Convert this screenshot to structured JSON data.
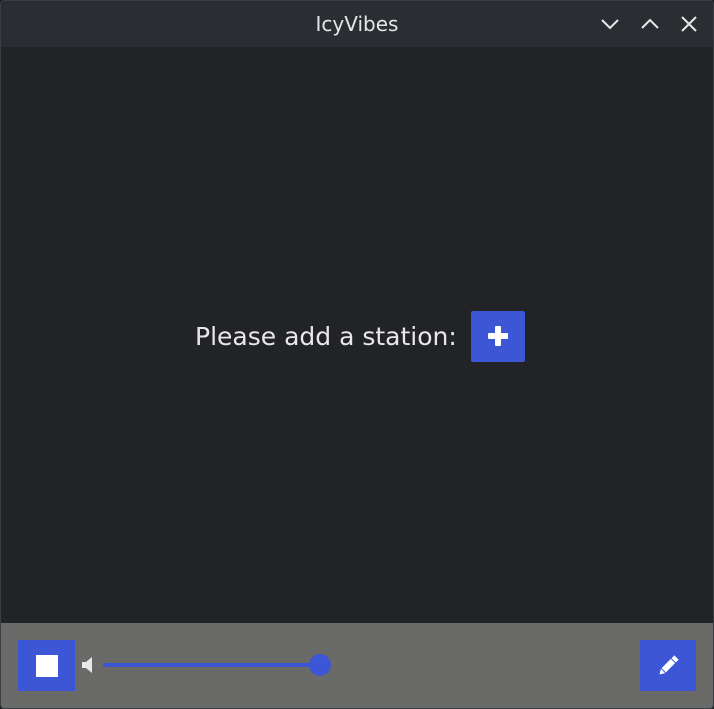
{
  "window": {
    "title": "IcyVibes",
    "controls": {
      "minimize_icon": "chevron-down-icon",
      "maximize_icon": "chevron-up-icon",
      "close_icon": "close-icon"
    }
  },
  "main": {
    "prompt": "Please add a station:",
    "add_button_icon": "plus-icon"
  },
  "player": {
    "stop_button_icon": "stop-icon",
    "volume_icon": "speaker-icon",
    "volume_level": 1.0,
    "edit_button_icon": "pencil-icon"
  },
  "colors": {
    "accent": "#3c56d6",
    "titlebar_bg": "#2a2e33",
    "content_bg": "#222327",
    "bottombar_bg": "#6a6b69",
    "text": "#e8e8e8"
  }
}
